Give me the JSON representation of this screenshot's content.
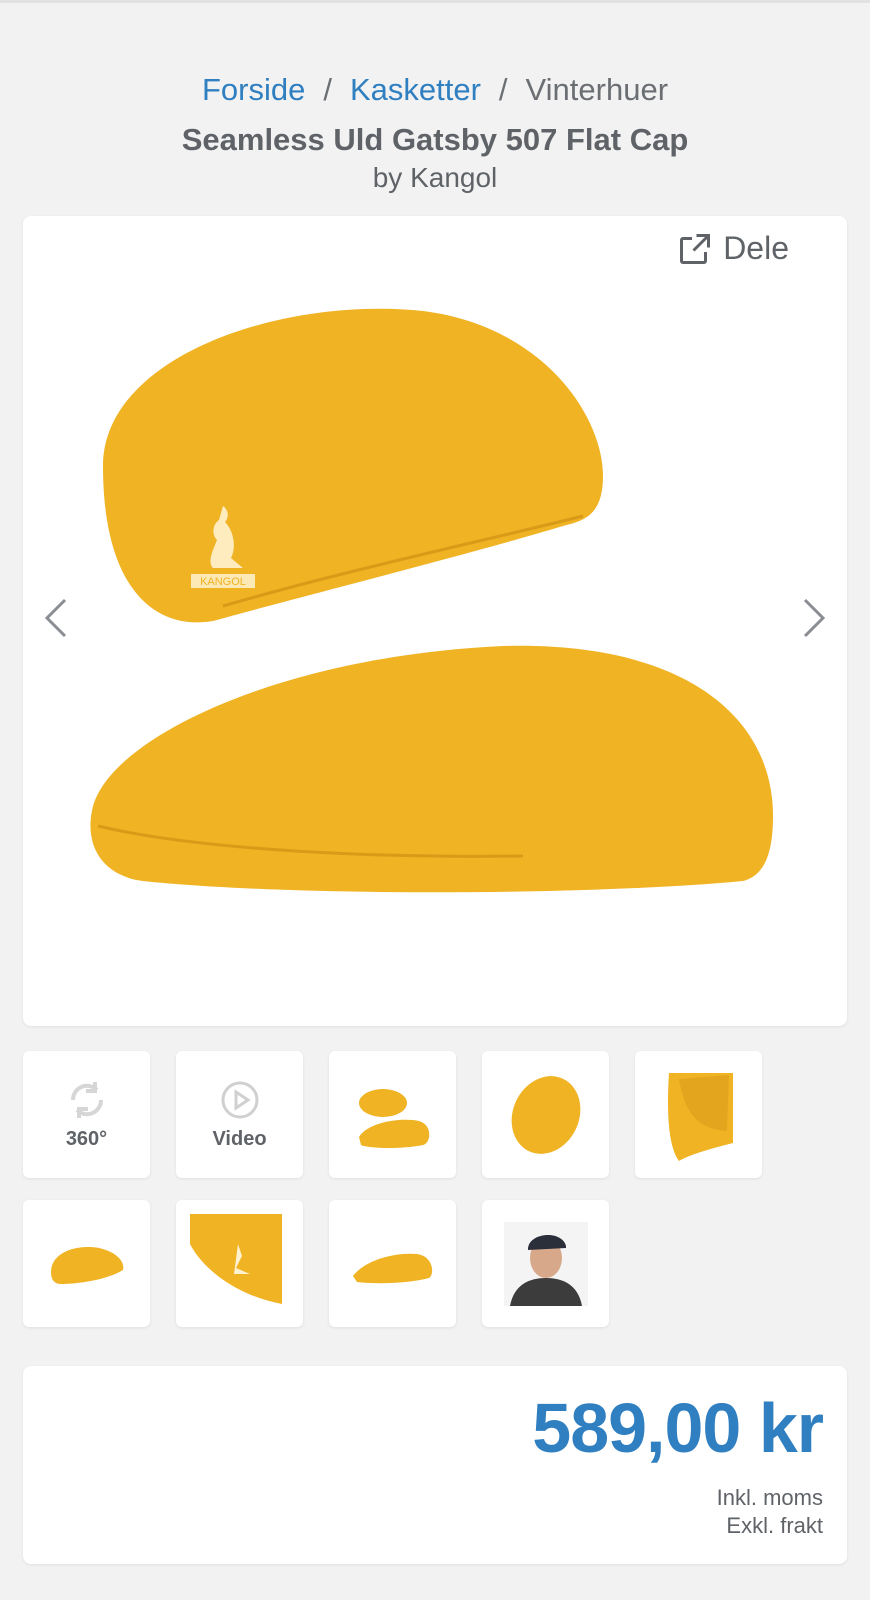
{
  "breadcrumb": {
    "items": [
      "Forside",
      "Kasketter",
      "Vinterhuer"
    ],
    "separator": "/"
  },
  "product": {
    "title": "Seamless Uld Gatsby 507 Flat Cap",
    "brand": "by Kangol",
    "share_label": "Dele",
    "logo_text": "KANGOL"
  },
  "thumbnails": {
    "spin_label": "360°",
    "video_label": "Video"
  },
  "pricing": {
    "price": "589,00 kr",
    "vat_note": "Inkl. moms",
    "shipping_note": "Exkl. frakt"
  },
  "colors": {
    "accent": "#2f7fc1",
    "cap": "#efb323",
    "background": "#f2f2f2"
  }
}
